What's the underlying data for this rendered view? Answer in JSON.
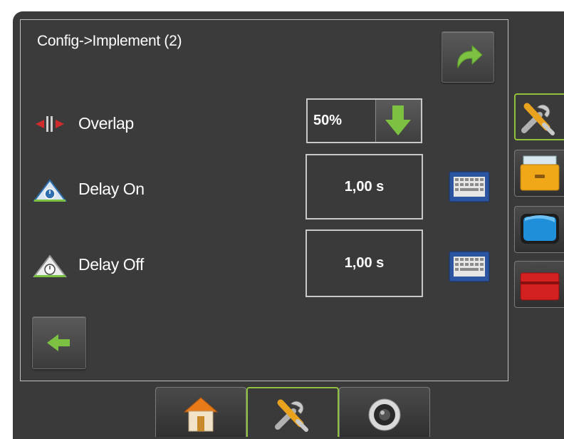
{
  "screen": {
    "title": "Config->Implement (2)"
  },
  "rows": {
    "overlap": {
      "label": "Overlap",
      "value": "50%"
    },
    "delay_on": {
      "label": "Delay On",
      "value": "1,00 s"
    },
    "delay_off": {
      "label": "Delay Off",
      "value": "1,00 s"
    }
  },
  "icons": {
    "next_page": "redo-arrow-icon",
    "back": "back-arrow-icon",
    "dropdown": "down-arrow-icon",
    "keyboard": "keyboard-icon",
    "overlap": "overlap-icon",
    "delay_on": "delay-on-icon",
    "delay_off": "delay-off-icon",
    "side_tabs": [
      "tools-icon",
      "file-cabinet-icon",
      "monitor-icon",
      "toolbox-icon"
    ],
    "bottom_tabs": [
      "home-icon",
      "tools-icon",
      "camera-icon"
    ]
  },
  "colors": {
    "accent_green": "#8fc23a",
    "background": "#3a3a3a",
    "text": "#ffffff"
  }
}
